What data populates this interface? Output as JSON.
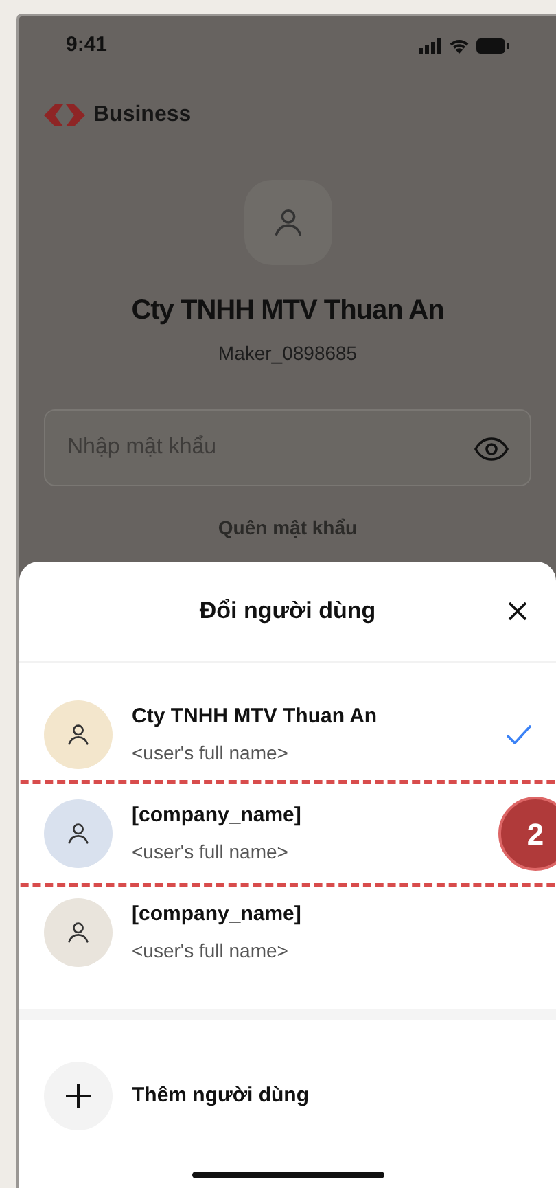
{
  "status_bar": {
    "time": "9:41"
  },
  "header": {
    "brand": "Business"
  },
  "profile": {
    "company": "Cty TNHH MTV Thuan An",
    "username": "Maker_0898685"
  },
  "password_field": {
    "placeholder": "Nhập mật khẩu"
  },
  "forgot_link": "Quên mật khẩu",
  "sheet": {
    "title": "Đổi người dùng",
    "users": [
      {
        "company": "Cty TNHH MTV Thuan An",
        "full_name": "<user's full name>",
        "selected": true,
        "highlighted": false,
        "color": "#f3e6cc"
      },
      {
        "company": "[company_name]",
        "full_name": "<user's full name>",
        "selected": false,
        "highlighted": true,
        "color": "#d9e1ee"
      },
      {
        "company": "[company_name]",
        "full_name": "<user's full name>",
        "selected": false,
        "highlighted": false,
        "color": "#e9e4dc"
      }
    ],
    "add_user": "Thêm người dùng"
  },
  "annotation": {
    "label": "2"
  }
}
